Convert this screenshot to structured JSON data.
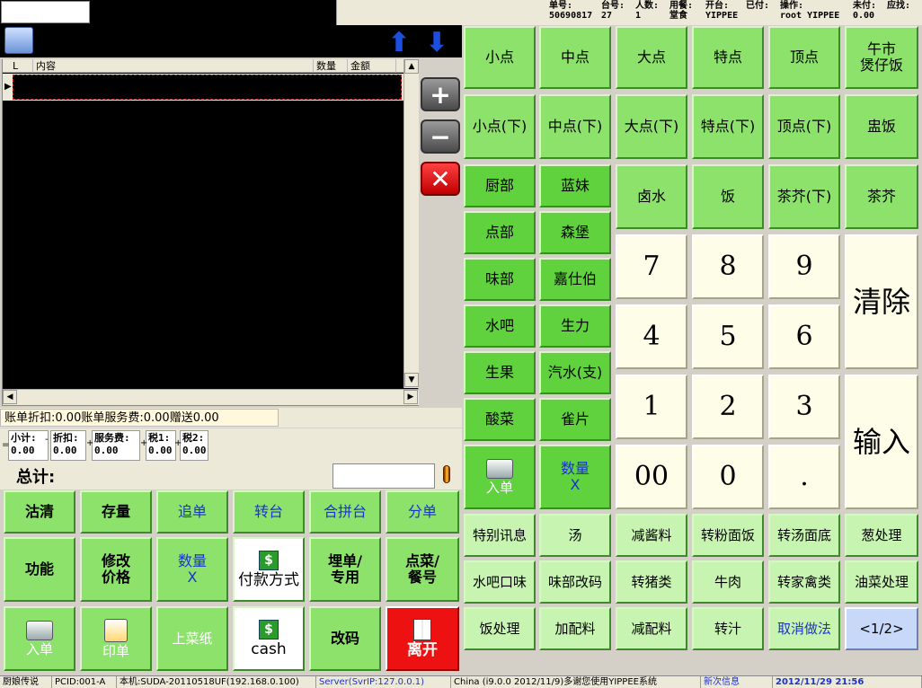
{
  "header": {
    "order_no_label": "单号:",
    "order_no": "50690817",
    "table_label": "台号:",
    "table_no": "27",
    "people_label": "人数:",
    "people": "1",
    "dining_label": "用餐:",
    "dining": "堂食",
    "opened_label": "开台:",
    "opened_by": "YIPPEE",
    "paid_label": "已付:",
    "operator_label": "操作:",
    "operator": "root YIPPEE",
    "unpaid_label": "未付:",
    "unpaid": "0.00",
    "receivable_label": "应找:"
  },
  "grid": {
    "columns": [
      "L",
      "内容",
      "数量",
      "金额"
    ]
  },
  "summary": {
    "discount_text": "账单折扣:",
    "discount": "0.00",
    "service_text": "账单服务费:",
    "service": "0.00",
    "gift_text": "赠送",
    "gift": "0.00",
    "subtotal_label": "小计:",
    "subtotal": "0.00",
    "item_discount_label": "折扣:",
    "item_discount": "0.00",
    "service_fee_label": "服务费:",
    "service_fee": "0.00",
    "tax1_label": "税1:",
    "tax1": "0.00",
    "tax2_label": "税2:",
    "tax2": "0.00",
    "total_label": "总计:"
  },
  "left_buttons": {
    "r1": [
      "沽清",
      "存量",
      "追单",
      "转台",
      "合拼台",
      "分单"
    ],
    "r2": [
      "功能",
      "修改\n价格",
      "数量\nX",
      "付款方式",
      "埋单/\n专用",
      "点菜/\n餐号"
    ],
    "r3": [
      "入单",
      "印单",
      "上菜纸",
      "cash",
      "改码",
      "离开"
    ]
  },
  "categories": {
    "row1": [
      "小点",
      "中点",
      "大点",
      "特点",
      "顶点",
      "午市\n煲仔饭"
    ],
    "row2": [
      "小点(下)",
      "中点(下)",
      "大点(下)",
      "特点(下)",
      "顶点(下)",
      "盅饭"
    ],
    "row3": [
      "卤水",
      "饭",
      "茶芥(下)",
      "茶芥"
    ],
    "depts": [
      [
        "厨部",
        "蓝妹"
      ],
      [
        "点部",
        "森堡"
      ],
      [
        "味部",
        "嘉仕伯"
      ],
      [
        "水吧",
        "生力"
      ],
      [
        "生果",
        "汽水(支)"
      ],
      [
        "酸菜",
        "雀片"
      ]
    ]
  },
  "keypad": {
    "keys": [
      "7",
      "8",
      "9",
      "4",
      "5",
      "6",
      "1",
      "2",
      "3",
      "00",
      "0",
      "."
    ],
    "clear": "清除",
    "enter": "输入"
  },
  "right_actions": {
    "submit": "入单",
    "qty": "数量\nX"
  },
  "modifiers": {
    "r1": [
      "特别讯息",
      "汤",
      "减酱料",
      "转粉面饭",
      "转汤面底",
      "葱处理"
    ],
    "r2": [
      "水吧口味",
      "味部改码",
      "转猪类",
      "牛肉",
      "转家禽类",
      "油菜处理"
    ],
    "r3": [
      "饭处理",
      "加配料",
      "减配料",
      "转汁",
      "取消做法",
      "<1/2>"
    ]
  },
  "status": {
    "s1": "厨娘传说",
    "s2": "PCID:001-A",
    "s3": "本机:SUDA-20110518UF(192.168.0.100)",
    "s4": "Server(SvrIP:127.0.0.1)",
    "s5": "China (i9.0.0 2012/11/9)多谢您使用YIPPEE系统",
    "s6": "新次信息",
    "s7": "2012/11/29 21:56"
  },
  "colors": {
    "button_green": "#8de26c",
    "keypad_bg": "#fdfde8",
    "exit_red": "#ee1111",
    "pager_blue": "#c8d8f8"
  }
}
